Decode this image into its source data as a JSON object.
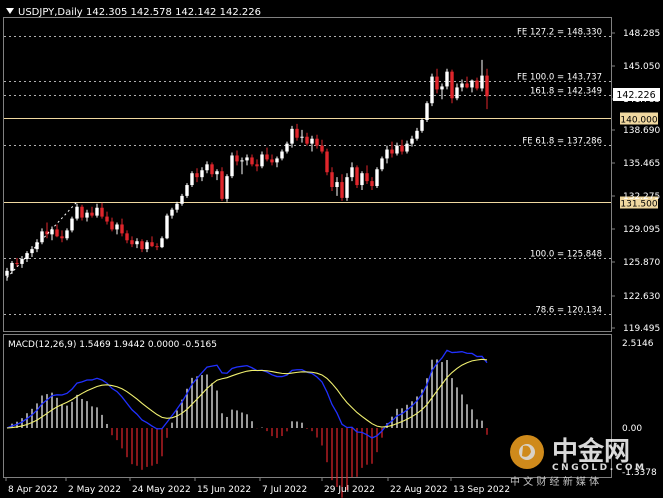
{
  "header": {
    "symbol_line": "USDJPY,Daily",
    "ohlc": "142.305 142.578 142.142 142.226"
  },
  "colors": {
    "background": "#000000",
    "bull": "#ffffff",
    "bear": "#e0262c",
    "grid": "#808080",
    "level": "#f0d8a0",
    "macd_line": "#2030ff",
    "signal_line": "#f0f070",
    "hist_pos": "#ffffff",
    "hist_neg": "#e0262c",
    "price_tag": "#ffffff"
  },
  "price_axis": {
    "ticks": [
      "148.285",
      "145.050",
      "141.785",
      "138.690",
      "135.465",
      "132.275",
      "129.095",
      "125.870",
      "122.630",
      "119.495"
    ],
    "current_price": "142.226"
  },
  "levels": [
    {
      "label": "FE 127.2 = 148.330",
      "price": 148.33,
      "style": "dashed"
    },
    {
      "label": "FE 100.0 = 143.737",
      "price": 143.737,
      "style": "dashed"
    },
    {
      "label": "161.8 = 142.349",
      "price": 142.349,
      "style": "dashed"
    },
    {
      "label": "140.000",
      "price": 140.0,
      "style": "solid"
    },
    {
      "label": "FE 61.8 = 137.286",
      "price": 137.286,
      "style": "dashed"
    },
    {
      "label": "131.500",
      "price": 131.5,
      "style": "solid"
    },
    {
      "label": "100.0 = 125.848",
      "price": 125.848,
      "style": "dashed"
    },
    {
      "label": "78.6 = 120.134",
      "price": 120.134,
      "style": "dashed"
    }
  ],
  "time_axis": [
    "8 Apr 2022",
    "2 May 2022",
    "24 May 2022",
    "15 Jun 2022",
    "7 Jul 2022",
    "29 Jul 2022",
    "22 Aug 2022",
    "13 Sep 2022"
  ],
  "macd": {
    "label": "MACD(12,26,9) 1.5469 1.9442 0.0000 -0.5165",
    "ticks": [
      "2.5146",
      "0.00",
      "-1.3378"
    ]
  },
  "watermark": {
    "brand": "中金网",
    "url": "CNGOLD.COM",
    "slogan": "中 文 财 经 新 媒 体"
  },
  "chart_data": {
    "type": "candlestick",
    "symbol": "USDJPY",
    "timeframe": "Daily",
    "ylim": [
      118.6,
      150.3
    ],
    "candles": [
      [
        124.0,
        124.8,
        123.5,
        124.5
      ],
      [
        124.5,
        125.5,
        124.2,
        125.3
      ],
      [
        125.3,
        125.8,
        124.9,
        125.2
      ],
      [
        125.2,
        126.0,
        124.8,
        125.7
      ],
      [
        125.7,
        126.5,
        125.4,
        126.3
      ],
      [
        126.3,
        127.0,
        125.9,
        126.7
      ],
      [
        126.7,
        127.7,
        126.4,
        127.4
      ],
      [
        127.4,
        128.8,
        127.2,
        128.5
      ],
      [
        128.5,
        129.4,
        127.8,
        128.2
      ],
      [
        128.2,
        129.0,
        127.6,
        128.7
      ],
      [
        128.7,
        129.2,
        127.9,
        128.0
      ],
      [
        128.0,
        128.6,
        127.4,
        127.8
      ],
      [
        127.8,
        128.8,
        127.6,
        128.6
      ],
      [
        128.6,
        130.0,
        128.4,
        129.8
      ],
      [
        129.8,
        131.3,
        129.6,
        131.0
      ],
      [
        131.0,
        131.2,
        129.6,
        129.9
      ],
      [
        129.9,
        130.7,
        129.5,
        130.4
      ],
      [
        130.4,
        131.0,
        129.9,
        130.1
      ],
      [
        130.1,
        131.3,
        129.9,
        130.9
      ],
      [
        130.9,
        131.4,
        129.8,
        130.0
      ],
      [
        130.0,
        130.5,
        129.2,
        129.5
      ],
      [
        129.5,
        129.9,
        128.5,
        128.7
      ],
      [
        128.7,
        129.4,
        128.2,
        129.2
      ],
      [
        129.2,
        129.8,
        128.0,
        128.3
      ],
      [
        128.3,
        128.6,
        127.3,
        127.6
      ],
      [
        127.6,
        128.0,
        126.9,
        127.2
      ],
      [
        127.2,
        127.8,
        126.8,
        127.5
      ],
      [
        127.5,
        127.7,
        126.4,
        126.7
      ],
      [
        126.7,
        127.6,
        126.4,
        127.4
      ],
      [
        127.4,
        128.0,
        126.9,
        127.0
      ],
      [
        127.0,
        127.3,
        126.6,
        126.9
      ],
      [
        126.9,
        128.0,
        126.8,
        127.8
      ],
      [
        127.8,
        130.3,
        127.7,
        130.1
      ],
      [
        130.1,
        130.9,
        129.8,
        130.7
      ],
      [
        130.7,
        131.5,
        130.4,
        131.3
      ],
      [
        131.3,
        132.3,
        131.1,
        132.1
      ],
      [
        132.1,
        133.4,
        131.9,
        133.2
      ],
      [
        133.2,
        134.6,
        133.0,
        134.4
      ],
      [
        134.4,
        134.9,
        133.5,
        134.0
      ],
      [
        134.0,
        135.0,
        133.6,
        134.7
      ],
      [
        134.7,
        135.6,
        134.4,
        135.3
      ],
      [
        135.3,
        135.5,
        134.0,
        134.3
      ],
      [
        134.3,
        134.8,
        133.7,
        134.6
      ],
      [
        134.6,
        135.0,
        131.6,
        131.8
      ],
      [
        131.8,
        134.3,
        131.5,
        134.1
      ],
      [
        134.1,
        136.5,
        133.9,
        136.2
      ],
      [
        136.2,
        136.7,
        135.2,
        135.6
      ],
      [
        135.6,
        136.0,
        134.3,
        135.7
      ],
      [
        135.7,
        136.3,
        135.2,
        136.0
      ],
      [
        136.0,
        136.3,
        135.1,
        135.3
      ],
      [
        135.3,
        135.8,
        134.6,
        135.1
      ],
      [
        135.1,
        136.6,
        134.9,
        136.3
      ],
      [
        136.3,
        137.0,
        135.6,
        135.8
      ],
      [
        135.8,
        136.3,
        135.2,
        135.5
      ],
      [
        135.5,
        136.1,
        135.0,
        135.9
      ],
      [
        135.9,
        136.8,
        135.7,
        136.6
      ],
      [
        136.6,
        137.6,
        136.4,
        137.4
      ],
      [
        137.4,
        139.2,
        137.0,
        138.9
      ],
      [
        138.9,
        139.4,
        137.7,
        138.0
      ],
      [
        138.0,
        138.8,
        137.5,
        138.1
      ],
      [
        138.1,
        138.5,
        137.2,
        137.4
      ],
      [
        137.4,
        138.2,
        136.6,
        137.9
      ],
      [
        137.9,
        138.3,
        136.9,
        137.2
      ],
      [
        137.2,
        137.8,
        136.4,
        136.6
      ],
      [
        136.6,
        136.9,
        134.2,
        134.5
      ],
      [
        134.5,
        135.0,
        132.6,
        133.0
      ],
      [
        133.0,
        134.0,
        132.1,
        133.5
      ],
      [
        133.5,
        134.3,
        131.6,
        131.9
      ],
      [
        131.9,
        134.4,
        131.6,
        134.0
      ],
      [
        134.0,
        135.5,
        133.6,
        135.0
      ],
      [
        135.0,
        135.2,
        132.9,
        133.2
      ],
      [
        133.2,
        134.6,
        132.7,
        134.4
      ],
      [
        134.4,
        135.2,
        133.3,
        133.6
      ],
      [
        133.6,
        134.0,
        132.7,
        133.1
      ],
      [
        133.1,
        135.0,
        132.9,
        134.8
      ],
      [
        134.8,
        136.1,
        134.6,
        135.9
      ],
      [
        135.9,
        137.2,
        135.4,
        136.8
      ],
      [
        136.8,
        137.6,
        136.0,
        136.4
      ],
      [
        136.4,
        137.5,
        136.2,
        137.2
      ],
      [
        137.2,
        137.8,
        136.3,
        136.6
      ],
      [
        136.6,
        137.7,
        136.4,
        137.4
      ],
      [
        137.4,
        138.2,
        137.1,
        137.9
      ],
      [
        137.9,
        139.0,
        137.7,
        138.7
      ],
      [
        138.7,
        140.0,
        138.5,
        139.8
      ],
      [
        139.8,
        141.7,
        139.6,
        141.5
      ],
      [
        141.5,
        144.5,
        141.2,
        144.2
      ],
      [
        144.2,
        145.0,
        142.5,
        142.9
      ],
      [
        142.9,
        143.5,
        141.9,
        143.2
      ],
      [
        143.2,
        145.0,
        142.9,
        144.7
      ],
      [
        144.7,
        144.9,
        141.5,
        142.0
      ],
      [
        142.0,
        143.5,
        141.8,
        143.1
      ],
      [
        143.1,
        143.9,
        142.7,
        143.5
      ],
      [
        143.5,
        144.2,
        143.0,
        143.1
      ],
      [
        143.1,
        143.9,
        142.6,
        143.8
      ],
      [
        143.8,
        144.1,
        142.8,
        143.0
      ],
      [
        143.0,
        145.9,
        142.7,
        144.3
      ],
      [
        144.3,
        145.0,
        140.9,
        142.2
      ]
    ],
    "macd_values": {
      "macd_start": 1.2,
      "macd_peak_jun": 2.2,
      "macd_trough_aug": -1.35,
      "macd_peak_sep": 2.45,
      "macd_last": 1.5469,
      "signal_last": 1.9442,
      "hist_last": -0.5165
    }
  }
}
